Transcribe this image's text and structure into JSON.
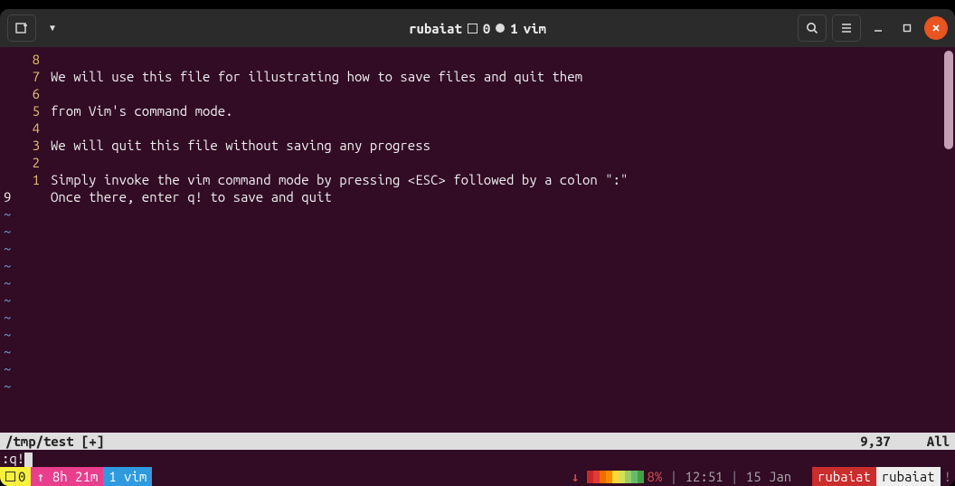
{
  "titlebar": {
    "title_user": "rubaiat",
    "title_sep1": "▢",
    "title_idx": "0",
    "title_dot": "●",
    "title_win": "1",
    "title_app": "vim"
  },
  "gutter": [
    "8",
    "7",
    "6",
    "5",
    "4",
    "3",
    "2",
    "1",
    "9"
  ],
  "content_lines": [
    "",
    "We will use this file for illustrating how to save files and quit them",
    "",
    "from Vim's command mode.",
    "",
    "We will quit this file without saving any progress",
    "",
    "Simply invoke the vim command mode by pressing <ESC> followed by a colon \":\"",
    "Once there, enter q! to save and quit"
  ],
  "tilde_count": 11,
  "statusline": {
    "file": "/tmp/test [+]",
    "pos": "9,37",
    "pct": "All"
  },
  "cmdline": {
    "text": ":q!"
  },
  "tmux": {
    "session": "0",
    "uptime": "8h 21m",
    "window": "1 vim",
    "battery_pct": "8%",
    "time": "12:51",
    "date": "15 Jan",
    "user": "rubaiat",
    "host": "rubaiat"
  }
}
